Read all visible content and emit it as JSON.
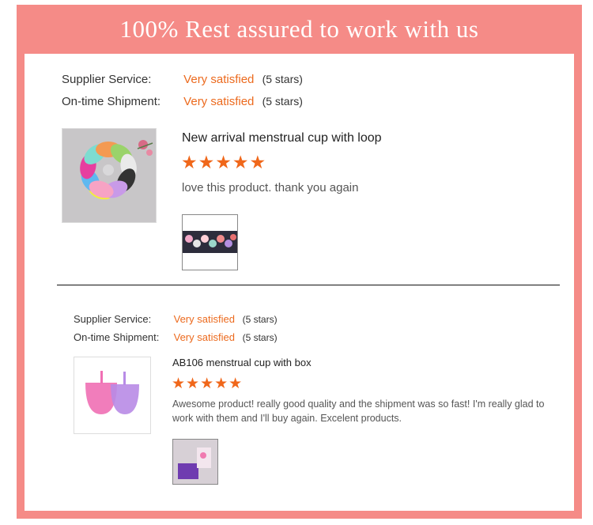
{
  "banner": {
    "title": "100% Rest assured to work with us"
  },
  "reviews": [
    {
      "supplier_label": "Supplier Service:",
      "supplier_value": "Very satisfied",
      "supplier_stars": "(5 stars)",
      "shipment_label": "On-time Shipment:",
      "shipment_value": "Very satisfied",
      "shipment_stars": "(5 stars)",
      "product_title": "New arrival menstrual cup with loop",
      "rating": 5,
      "star_glyphs": "★★★★★",
      "comment": "love this product. thank you again"
    },
    {
      "supplier_label": "Supplier Service:",
      "supplier_value": "Very satisfied",
      "supplier_stars": "(5 stars)",
      "shipment_label": "On-time Shipment:",
      "shipment_value": "Very satisfied",
      "shipment_stars": "(5 stars)",
      "product_title": "AB106 menstrual cup with box",
      "rating": 5,
      "star_glyphs": "★★★★★",
      "comment": "Awesome product! really good quality and the shipment was so fast! I'm really glad to work with them and I'll buy again. Excelent products."
    }
  ],
  "colors": {
    "frame": "#f58b87",
    "accent": "#ec6a1e",
    "star": "#f0671a"
  }
}
